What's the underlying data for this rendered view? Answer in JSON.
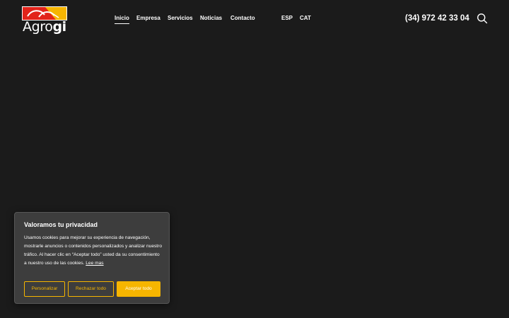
{
  "colors": {
    "background": "#1b1b1b",
    "accent": "#f6b500",
    "logo_red": "#e2231a",
    "logo_yellow": "#f6b500",
    "modal_background": "#3d3d3d"
  },
  "brand": {
    "name_regular": "Agro",
    "name_bold": "gi"
  },
  "nav": {
    "items": [
      {
        "label": "Inicio",
        "active": true
      },
      {
        "label": "Empresa",
        "active": false
      },
      {
        "label": "Servicios",
        "active": false
      },
      {
        "label": "Noticias",
        "active": false
      },
      {
        "label": "Contacto",
        "active": false
      }
    ]
  },
  "languages": [
    {
      "label": "ESP"
    },
    {
      "label": "CAT"
    }
  ],
  "phone": "(34) 972 42 33 04",
  "icons": {
    "search": "search-icon",
    "logo": "agrogi-logo-mark"
  },
  "cookie_banner": {
    "title": "Valoramos tu privacidad",
    "body": "Usamos cookies para mejorar su experiencia de navegación, mostrarle anuncios o contenidos personalizados y analizar nuestro tráfico. Al hacer clic en “Aceptar todo” usted da su consentimiento a nuestro uso de las cookies.",
    "link_label": "Lee mas",
    "buttons": {
      "customize": "Personalizar",
      "reject": "Rechazar todo",
      "accept": "Aceptar todo"
    }
  }
}
